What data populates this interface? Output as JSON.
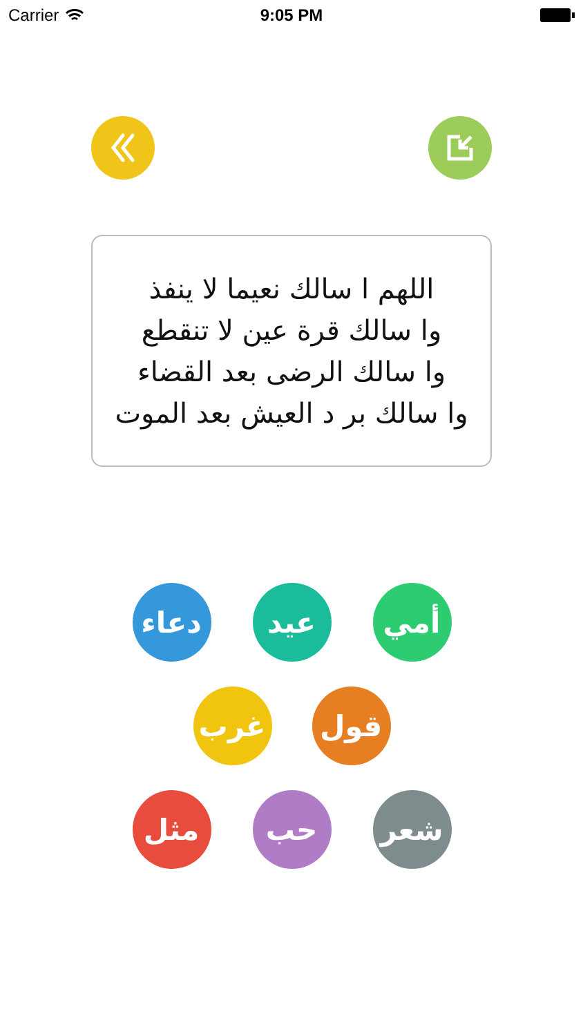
{
  "status_bar": {
    "carrier": "Carrier",
    "time": "9:05 PM"
  },
  "quote": {
    "lines": [
      "اللهم ا سالك نعيما لا ينفذ",
      "وا سالك قرة عين لا تنقطع",
      "وا سالك الرضى بعد القضاء",
      "وا سالك بر د العيش بعد الموت"
    ]
  },
  "categories": [
    [
      {
        "label": "أمي",
        "color": "#2ecc71"
      },
      {
        "label": "عيد",
        "color": "#1abc9c"
      },
      {
        "label": "دعاء",
        "color": "#3498db"
      }
    ],
    [
      {
        "label": "قول",
        "color": "#e67e22"
      },
      {
        "label": "غرب",
        "color": "#f1c40f"
      }
    ],
    [
      {
        "label": "شعر",
        "color": "#7f8c8d"
      },
      {
        "label": "حب",
        "color": "#b07cc6"
      },
      {
        "label": "مثل",
        "color": "#e74c3c"
      }
    ]
  ]
}
